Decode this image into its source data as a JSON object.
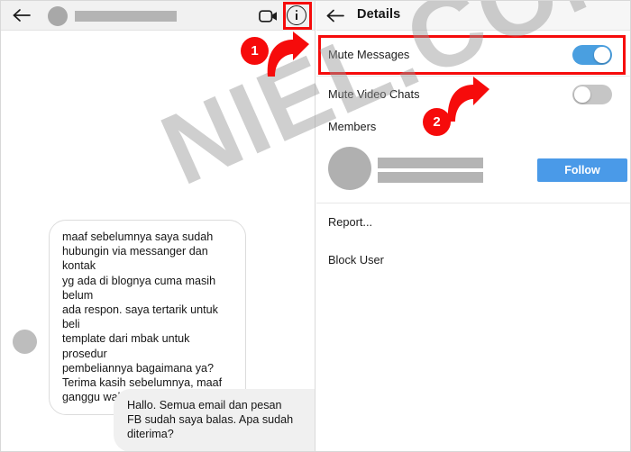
{
  "chat": {
    "header": {
      "back_icon": "back-arrow-icon",
      "avatar": "contact-avatar",
      "name_redacted": "",
      "video_icon": "video-camera-icon",
      "info_icon": "info-circle-icon"
    },
    "messages": [
      {
        "direction": "incoming",
        "text": "maaf sebelumnya saya sudah\nhubungin via messanger dan kontak\nyg ada di blognya cuma masih belum\nada respon. saya tertarik untuk beli\ntemplate dari mbak untuk prosedur\npembeliannya bagaimana ya?\nTerima kasih sebelumnya, maaf\nganggu waktunya"
      },
      {
        "direction": "outgoing",
        "text": "Hallo. Semua email dan pesan\nFB sudah saya balas. Apa sudah\nditerima?"
      }
    ]
  },
  "details": {
    "header": {
      "back_icon": "back-arrow-icon",
      "title": "Details"
    },
    "rows": [
      {
        "label": "Mute Messages",
        "toggle": "on"
      },
      {
        "label": "Mute Video Chats",
        "toggle": "off"
      }
    ],
    "members_label": "Members",
    "member": {
      "avatar": "member-avatar",
      "name_redacted": "",
      "follow_label": "Follow"
    },
    "actions": [
      {
        "label": "Report..."
      },
      {
        "label": "Block User"
      }
    ]
  },
  "annotations": {
    "step1": "1",
    "step2": "2",
    "highlight_color": "#f60b0b"
  },
  "watermark": {
    "text": "NIEL.COM"
  }
}
